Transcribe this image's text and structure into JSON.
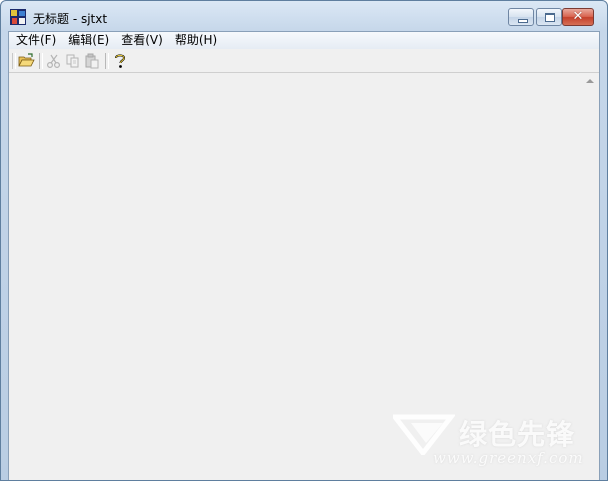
{
  "window": {
    "title": "无标题 - sjtxt",
    "close_glyph": "✕"
  },
  "menubar": {
    "items": [
      "文件(F)",
      "编辑(E)",
      "查看(V)",
      "帮助(H)"
    ]
  },
  "toolbar": {
    "buttons": [
      {
        "icon": "open-folder-icon",
        "enabled": true
      },
      {
        "icon": "cut-icon",
        "enabled": false
      },
      {
        "icon": "copy-icon",
        "enabled": false
      },
      {
        "icon": "paste-icon",
        "enabled": false
      },
      {
        "icon": "help-icon",
        "enabled": true
      }
    ]
  },
  "editor": {
    "content": ""
  },
  "watermark": {
    "title": "绿色先锋",
    "url": "www.greenxf.com"
  }
}
